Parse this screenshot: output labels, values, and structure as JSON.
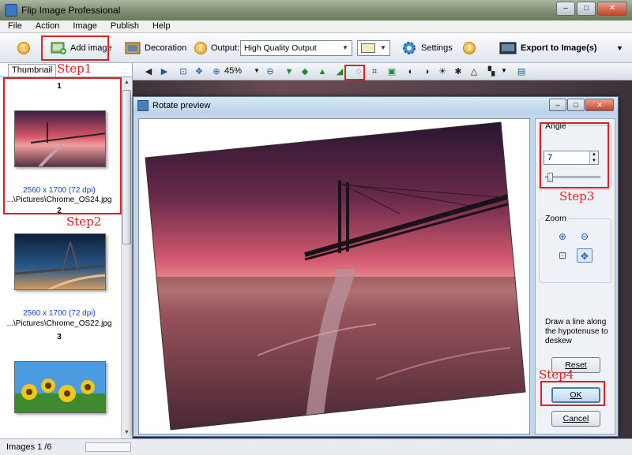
{
  "window": {
    "title": "Flip Image Professional",
    "controls": {
      "minimize": "–",
      "maximize": "□",
      "close": "✕"
    }
  },
  "menu": [
    "File",
    "Action",
    "Image",
    "Publish",
    "Help"
  ],
  "toolbar": {
    "step1_num": "1",
    "add_image": "Add image",
    "decoration": "Decoration",
    "step2_num": "2",
    "output_label": "Output:",
    "output_value": "High Quality Output",
    "settings": "Settings",
    "step3_num": "3",
    "export": "Export to Image(s)"
  },
  "annotations": {
    "step1": "Step1",
    "step2": "Step2",
    "step3": "Step3",
    "step4": "Step4",
    "color": "#e02020"
  },
  "left_panel": {
    "tab": "Thumbnail",
    "thumbnails": [
      {
        "num": "1",
        "dims": "2560 x 1700 (72 dpi)",
        "path": "...\\Pictures\\Chrome_OS24.jpg"
      },
      {
        "num": "2",
        "dims": "2560 x 1700 (72 dpi)",
        "path": "...\\Pictures\\Chrome_OS22.jpg"
      },
      {
        "num": "3",
        "dims": "",
        "path": ""
      }
    ]
  },
  "toolbar2": {
    "zoom": "45%"
  },
  "dialog": {
    "title": "Rotate preview",
    "angle_label": "Angle",
    "angle_value": "7",
    "angle_slider_fraction": 0.04,
    "zoom_label": "Zoom",
    "hint": "Draw a line along the hypotenuse to deskew",
    "reset": "Reset",
    "ok": "OK",
    "cancel": "Cancel"
  },
  "status": {
    "images": "Images 1 /6"
  }
}
